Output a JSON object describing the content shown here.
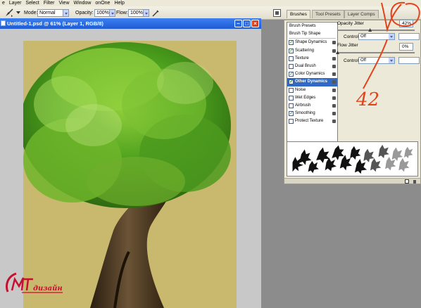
{
  "menu": [
    "e",
    "Layer",
    "Select",
    "Filter",
    "View",
    "Window",
    "onOne",
    "Help"
  ],
  "options": {
    "mode_label": "Mode:",
    "mode_value": "Normal",
    "opacity_label": "Opacity:",
    "opacity_value": "100%",
    "flow_label": "Flow:",
    "flow_value": "100%"
  },
  "panel_tabs": [
    "Brushes",
    "Tool Presets",
    "Layer Comps"
  ],
  "document": {
    "title": "Untitled-1.psd @ 61% (Layer 1, RGB/8)"
  },
  "brush_panel": {
    "items": [
      {
        "label": "Brush Presets",
        "checkbox": false,
        "checked": false,
        "selected": false
      },
      {
        "label": "Brush Tip Shape",
        "checkbox": false,
        "checked": false,
        "selected": false
      },
      {
        "label": "Shape Dynamics",
        "checkbox": true,
        "checked": true,
        "selected": false
      },
      {
        "label": "Scattering",
        "checkbox": true,
        "checked": true,
        "selected": false
      },
      {
        "label": "Texture",
        "checkbox": true,
        "checked": false,
        "selected": false
      },
      {
        "label": "Dual Brush",
        "checkbox": true,
        "checked": false,
        "selected": false
      },
      {
        "label": "Color Dynamics",
        "checkbox": true,
        "checked": true,
        "selected": false
      },
      {
        "label": "Other Dynamics",
        "checkbox": true,
        "checked": true,
        "selected": true
      },
      {
        "label": "Noise",
        "checkbox": true,
        "checked": false,
        "selected": false
      },
      {
        "label": "Wet Edges",
        "checkbox": true,
        "checked": false,
        "selected": false
      },
      {
        "label": "Airbrush",
        "checkbox": true,
        "checked": false,
        "selected": false
      },
      {
        "label": "Smoothing",
        "checkbox": true,
        "checked": true,
        "selected": false
      },
      {
        "label": "Protect Texture",
        "checkbox": true,
        "checked": false,
        "selected": false
      }
    ],
    "opacity_jitter_label": "Opacity Jitter",
    "opacity_jitter_value": "42%",
    "opacity_jitter_level": 0.42,
    "control_label": "Control:",
    "control_value": "Off",
    "flow_jitter_label": "Flow Jitter",
    "flow_jitter_value": "0%",
    "flow_jitter_level": 0,
    "control2_label": "Control:",
    "control2_value": "Off"
  },
  "annotation": {
    "text": "42",
    "color": "#e2431b"
  },
  "logo": {
    "initials": "MT",
    "word": "дизайн",
    "color": "#c8102e"
  }
}
